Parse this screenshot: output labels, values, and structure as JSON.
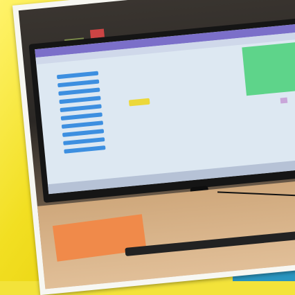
{
  "image": {
    "description_subjects": [
      "monitor-screen",
      "coding-blocks",
      "stage-green",
      "desk",
      "orange-pad",
      "keyboard"
    ],
    "colors": {
      "frame_bg_yellow": "#f2df22",
      "frame_bg_blue": "#1f7fa8",
      "screen_bg": "#dde8f2",
      "screen_topbar": "#7b6fc9",
      "stage_green": "#5ed48a",
      "blocks_blue": "#3d8fe0",
      "block_yellow": "#ecd83a",
      "desk": "#d9b590",
      "orange_pad": "#f08a4a"
    }
  }
}
